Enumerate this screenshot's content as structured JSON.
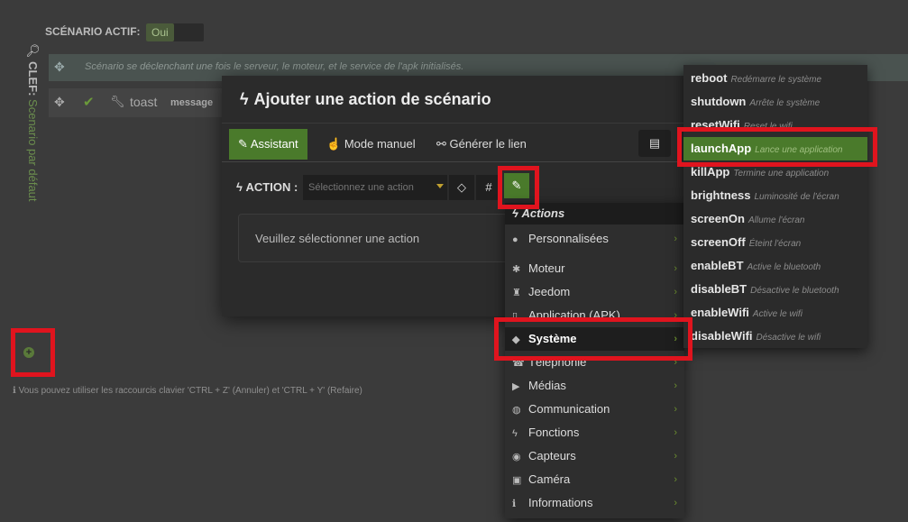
{
  "background": {
    "scenario_active_label": "SCÉNARIO ACTIF:",
    "scenario_active_value": "Oui",
    "key_label": "CLEF:",
    "key_value": "Scenario par défaut",
    "trigger_text": "Scénario se déclenchant une fois le serveur, le moteur, et le service de l'apk initialisés.",
    "row_action": "toast",
    "row_param": "message",
    "hint_text": "Vous pouvez utiliser les raccourcis clavier 'CTRL + Z' (Annuler) et 'CTRL + Y' (Refaire)"
  },
  "modal": {
    "title": "Ajouter une action de scénario",
    "tabs": [
      {
        "label": "Assistant",
        "active": true
      },
      {
        "label": "Mode manuel",
        "active": false
      },
      {
        "label": "Générer le lien",
        "active": false
      }
    ],
    "action_label": "ACTION :",
    "action_placeholder": "Sélectionnez une action",
    "empty_text": "Veuillez sélectionner une action"
  },
  "actions_menu": {
    "header": "Actions",
    "items": [
      {
        "label": "Personnalisées",
        "icon": "user-icon"
      },
      {
        "label": "Moteur",
        "icon": "gear-icon"
      },
      {
        "label": "Jeedom",
        "icon": "jeedom-icon"
      },
      {
        "label": "Application (APK)",
        "icon": "mobile-icon"
      },
      {
        "label": "Système",
        "icon": "android-icon"
      },
      {
        "label": "Téléphonie",
        "icon": "phone-icon"
      },
      {
        "label": "Médias",
        "icon": "play-icon"
      },
      {
        "label": "Communication",
        "icon": "globe-icon"
      },
      {
        "label": "Fonctions",
        "icon": "bolt-icon"
      },
      {
        "label": "Capteurs",
        "icon": "eye-icon"
      },
      {
        "label": "Caméra",
        "icon": "camera-icon"
      },
      {
        "label": "Informations",
        "icon": "info-icon"
      }
    ]
  },
  "system_submenu": {
    "items": [
      {
        "name": "reboot",
        "desc": "Redémarre le système"
      },
      {
        "name": "shutdown",
        "desc": "Arrête le système"
      },
      {
        "name": "resetWifi",
        "desc": "Reset le wifi"
      },
      {
        "name": "launchApp",
        "desc": "Lance une application"
      },
      {
        "name": "killApp",
        "desc": "Termine une application"
      },
      {
        "name": "brightness",
        "desc": "Luminosité de l'écran"
      },
      {
        "name": "screenOn",
        "desc": "Allume l'écran"
      },
      {
        "name": "screenOff",
        "desc": "Éteint l'écran"
      },
      {
        "name": "enableBT",
        "desc": "Active le bluetooth"
      },
      {
        "name": "disableBT",
        "desc": "Désactive le bluetooth"
      },
      {
        "name": "enableWifi",
        "desc": "Active le wifi"
      },
      {
        "name": "disableWifi",
        "desc": "Désactive le wifi"
      }
    ]
  },
  "colors": {
    "accent_green": "#4a7a2b",
    "highlight_red": "#e0141e"
  }
}
